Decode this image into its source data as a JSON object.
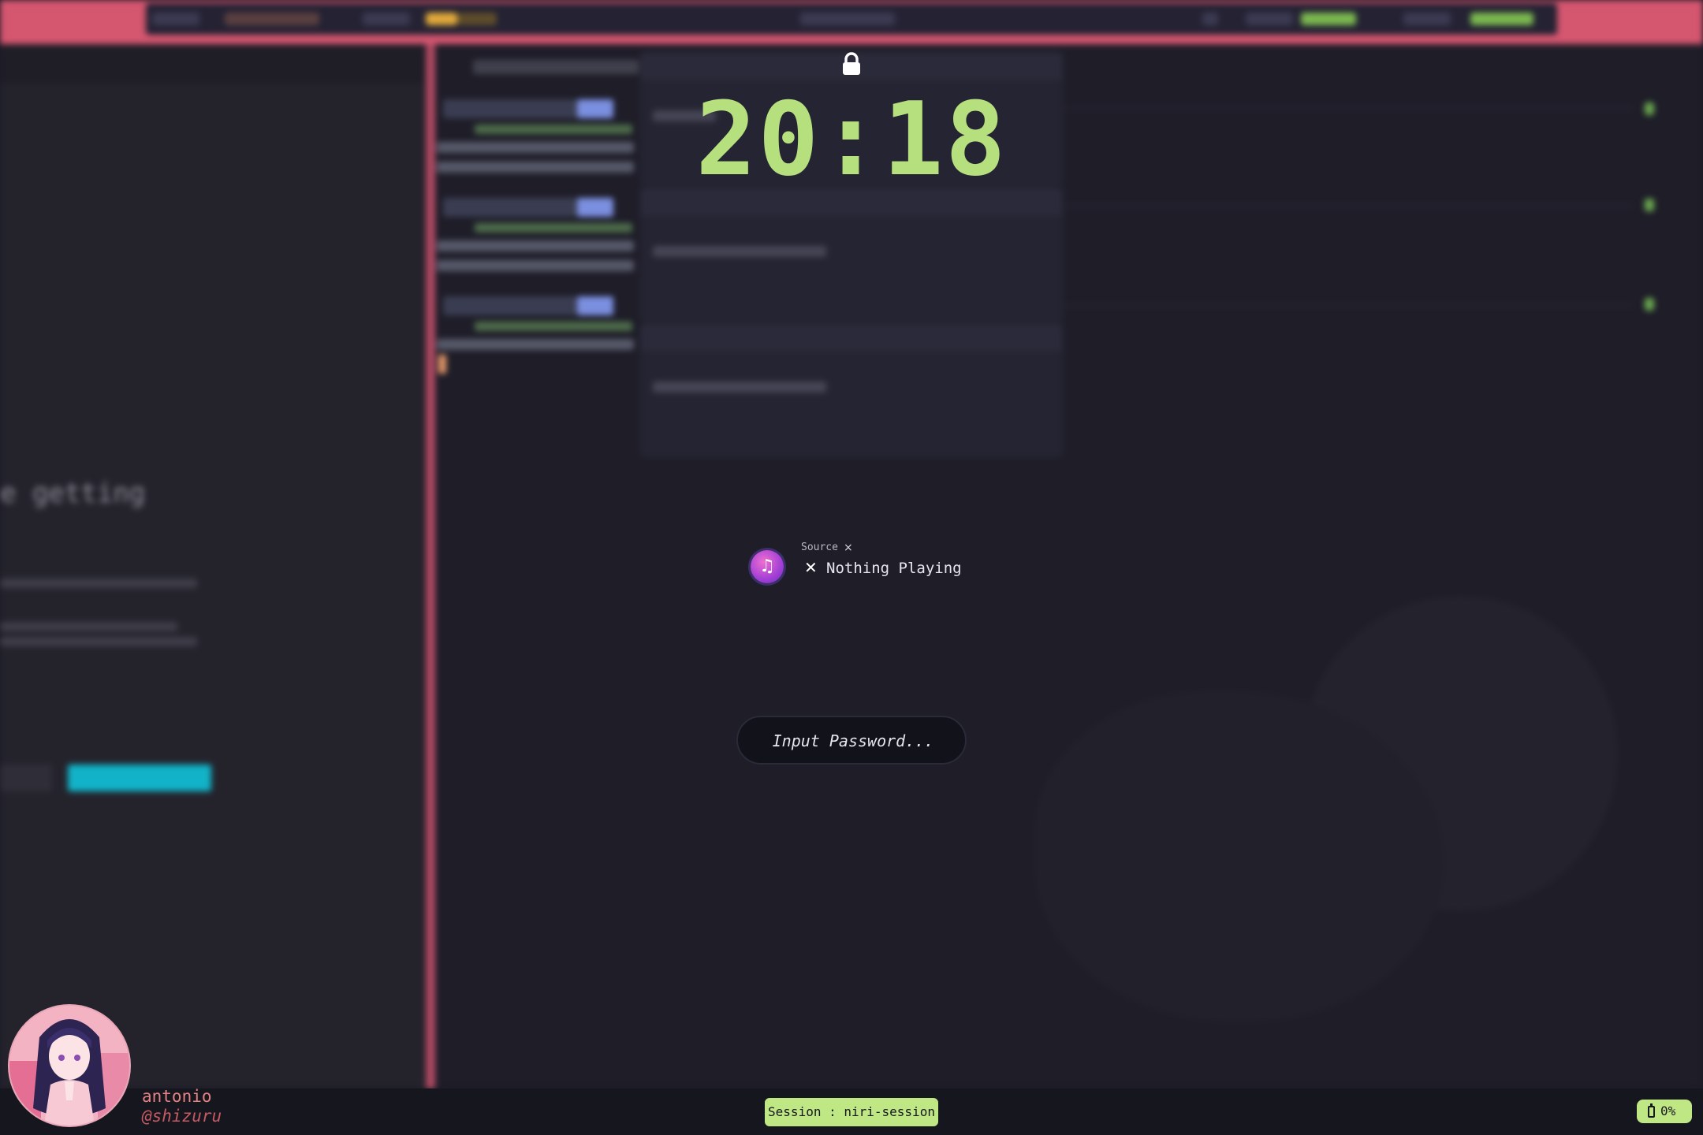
{
  "lock": {
    "icon": "lock-icon",
    "time": "20:18"
  },
  "media": {
    "icon": "music-note-icon",
    "source_label": "Source",
    "source_close_glyph": "×",
    "status_glyph": "✕",
    "title": "Nothing Playing"
  },
  "password": {
    "placeholder": "Input Password..."
  },
  "user": {
    "name": "antonio",
    "handle": "@shizuru"
  },
  "session": {
    "label": "Session : niri-session"
  },
  "battery": {
    "icon": "battery-icon",
    "value": "0%"
  },
  "colors": {
    "clock": "#b6df7e",
    "accent_green": "#bfe784",
    "username": "#e58383",
    "handle": "#c65a63",
    "background": "#1c1b26"
  }
}
